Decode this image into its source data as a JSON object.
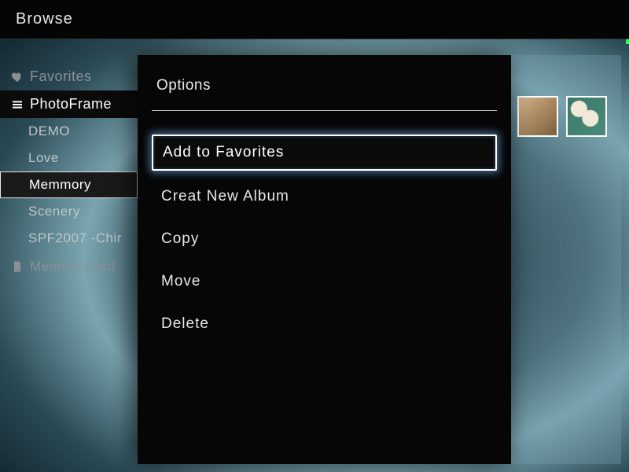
{
  "title": "Browse",
  "sidebar": {
    "favorites_label": "Favorites",
    "source_active": "PhotoFrame",
    "albums": [
      {
        "label": "DEMO",
        "selected": false
      },
      {
        "label": "Love",
        "selected": false
      },
      {
        "label": "Memmory",
        "selected": true
      },
      {
        "label": "Scenery",
        "selected": false
      },
      {
        "label": "SPF2007 -Chir",
        "selected": false
      }
    ],
    "source_other": "Memory Card"
  },
  "popup": {
    "title": "Options",
    "items": [
      {
        "label": "Add to Favorites",
        "highlight": true
      },
      {
        "label": "Creat New Album",
        "highlight": false
      },
      {
        "label": "Copy",
        "highlight": false
      },
      {
        "label": "Move",
        "highlight": false
      },
      {
        "label": "Delete",
        "highlight": false
      }
    ]
  }
}
